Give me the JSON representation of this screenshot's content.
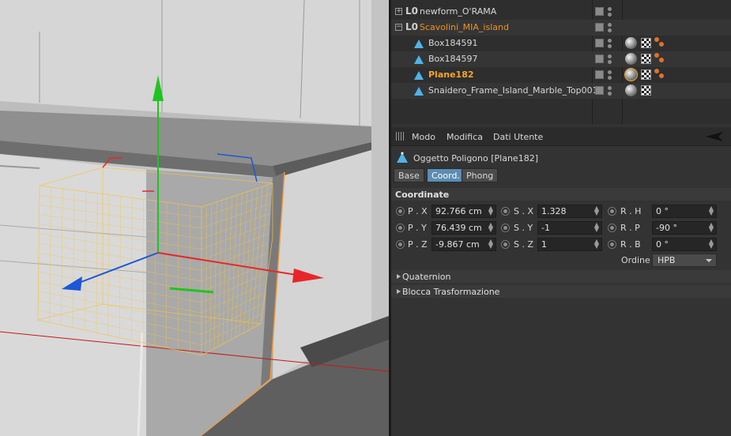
{
  "object_manager": {
    "rows": [
      {
        "name": "newform_O'RAMA",
        "style": "normal",
        "level": 0,
        "icon": "null-icon",
        "has_tags": false
      },
      {
        "name": "Scavolini_MIA_island",
        "style": "orange",
        "level": 0,
        "icon": "null-icon",
        "has_tags": false
      },
      {
        "name": "Box184591",
        "style": "normal",
        "level": 1,
        "icon": "polygon-icon",
        "has_tags": true
      },
      {
        "name": "Box184597",
        "style": "normal",
        "level": 1,
        "icon": "polygon-icon",
        "has_tags": true
      },
      {
        "name": "Plane182",
        "style": "selected",
        "level": 1,
        "icon": "polygon-icon",
        "has_tags": true
      },
      {
        "name": "Snaidero_Frame_Island_Marble_Top001",
        "style": "normal",
        "level": 1,
        "icon": "polygon-icon",
        "has_tags": true
      }
    ],
    "null_glyph": "L0"
  },
  "attribute_manager": {
    "menu": [
      "Modo",
      "Modifica",
      "Dati Utente"
    ],
    "object_title": "Oggetto Poligono [Plane182]",
    "tabs": [
      {
        "label": "Base",
        "active": false
      },
      {
        "label": "Coord.",
        "active": true
      },
      {
        "label": "Phong",
        "active": false
      }
    ],
    "section_title": "Coordinate",
    "fields": [
      {
        "label": "P . X",
        "value": "92.766 cm"
      },
      {
        "label": "S . X",
        "value": "1.328"
      },
      {
        "label": "R . H",
        "value": "0 °"
      },
      {
        "label": "P . Y",
        "value": "76.439 cm"
      },
      {
        "label": "S . Y",
        "value": "-1"
      },
      {
        "label": "R . P",
        "value": "-90 °"
      },
      {
        "label": "P . Z",
        "value": "-9.867 cm"
      },
      {
        "label": "S . Z",
        "value": "1"
      },
      {
        "label": "R . B",
        "value": "0 °"
      }
    ],
    "order_label": "Ordine",
    "order_value": "HPB",
    "collapsed_sections": [
      "Quaternion",
      "Blocca Trasformazione"
    ]
  },
  "colors": {
    "selected_text": "#f6a623",
    "layer_orange": "#f0921d",
    "active_tab": "#5b8db3",
    "axis_x": "#e8262a",
    "axis_y": "#1fc41f",
    "axis_z": "#1d56d8",
    "selection_wire": "#f5c542"
  }
}
